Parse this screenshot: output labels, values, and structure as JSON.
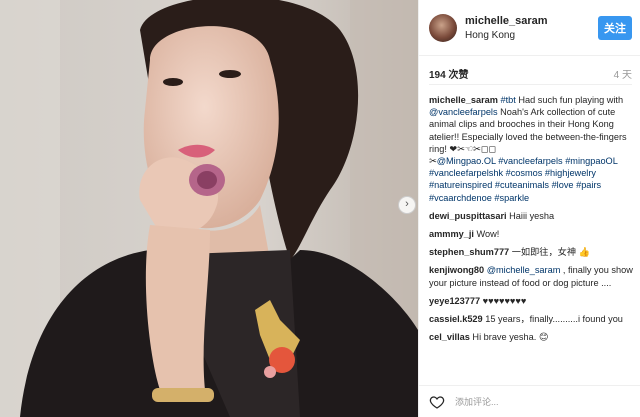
{
  "header": {
    "username": "michelle_saram",
    "location": "Hong Kong",
    "follow_label": "关注"
  },
  "stats": {
    "likes": "194 次赞",
    "time": "4 天"
  },
  "caption": {
    "username": "michelle_saram",
    "text1": "#tbt",
    "text2": " Had such fun playing with ",
    "text3": "@vancleefarpels",
    "text4": " Noah's Ark collection of cute animal clips and brooches in their Hong Kong atelier!! Especially loved the between-the-fingers ring! ❤✂☜✂◻◻",
    "text5": "✂",
    "text6": "@Mingpao.OL #vancleefarpels #mingpaoOL #vancleefarpelshk #cosmos #highjewelry #natureinspired #cuteanimals #love #pairs #vcaarchdenoe #sparkle"
  },
  "comments": [
    {
      "user": "dewi_puspittasari",
      "text": " Haiii yesha"
    },
    {
      "user": "ammmy_ji",
      "text": " Wow!"
    },
    {
      "user": "stephen_shum777",
      "text": " 一如即往，女神 👍"
    },
    {
      "user": "kenjiwong80",
      "mention": " @michelle_saram",
      "text": " , finally you show your picture instead of food or dog picture ...."
    },
    {
      "user": "yeye123777",
      "text": " ♥♥♥♥♥♥♥♥"
    },
    {
      "user": "cassiel.k529",
      "text": " 15 years，finally..........i found you"
    },
    {
      "user": "cel_villas",
      "text": " Hi brave yesha. 😊"
    }
  ],
  "footer": {
    "add_comment_placeholder": "添加评论..."
  },
  "icons": {
    "next": "chevron-right-icon",
    "like": "heart-icon"
  },
  "colors": {
    "follow_button": "#3897f0",
    "link": "#003569"
  }
}
